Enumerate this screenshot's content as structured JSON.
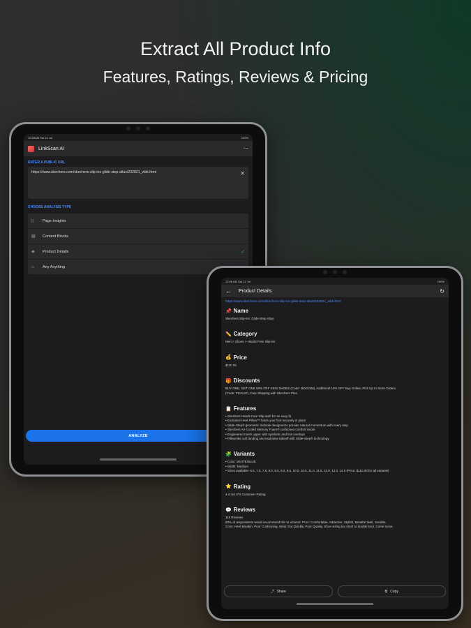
{
  "hero": {
    "title": "Extract All Product Info",
    "subtitle": "Features, Ratings, Reviews & Pricing"
  },
  "tablet_left": {
    "status": {
      "time": "10:46AM  Sat 12 Jul",
      "battery": "100%"
    },
    "app_title": "LinkScan AI",
    "menu_icon": "more-icon",
    "url_section_label": "ENTER A PUBLIC URL",
    "url_value": "https://www.skechers.com/skechers-slip-ins-glide-step-altus/232821_wbk.html",
    "analysis_label": "CHOOSE ANALYSIS TYPE",
    "analysis_options": [
      {
        "label": "Page Insights",
        "icon": "page-icon",
        "selected": false
      },
      {
        "label": "Content Blocks",
        "icon": "blocks-icon",
        "selected": false
      },
      {
        "label": "Product Details",
        "icon": "bag-icon",
        "selected": true
      },
      {
        "label": "Any Anything",
        "icon": "home-icon",
        "selected": false
      }
    ],
    "analyze_label": "ANALYZE"
  },
  "tablet_right": {
    "status": {
      "time": "12:46 AM  Sat 12 Jul",
      "battery": "100%"
    },
    "title": "Product Details",
    "link": "https://www.skechers.com/skechers-slip-ins-glide-step-altus/232821_wbk.html",
    "sections": {
      "name": {
        "emoji": "📌",
        "heading": "Name",
        "text": "Skechers Slip-ins: Glide-Step Altus"
      },
      "category": {
        "emoji": "✏️",
        "heading": "Category",
        "text": "Men > Shoes > Hands Free Slip-ins"
      },
      "price": {
        "emoji": "💰",
        "heading": "Price",
        "text": "$110.00"
      },
      "discounts": {
        "emoji": "🎁",
        "heading": "Discounts",
        "lines": [
          "BUY ONE, GET ONE 50% OFF KIDS SHOES (Code: BOGO50), Additional 10% OFF Buy Online, Pick Up In Store Orders",
          "(Code: PICKUP). Free Shipping with Skechers Plus."
        ]
      },
      "features": {
        "emoji": "📋",
        "heading": "Features",
        "lines": [
          "• Skechers Hands Free Slip-ins® for an easy fit",
          "• Exclusive Heel Pillow™ holds your foot securely in place",
          "• Glide-Step® geometric midsole designed to provide natural momentum with every step",
          "• Skechers Air-Cooled Memory Foam® cushioned comfort insole",
          "• Engineered mesh upper with synthetic and knit overlays",
          "• Pillow-like soft landing and explosive takeoff with Glide-Step® technology"
        ]
      },
      "variants": {
        "emoji": "🧩",
        "heading": "Variants",
        "lines": [
          "• Color: WHITE/BLUE",
          "• Width: Medium",
          "• Sizes available: 6.5, 7.0, 7.5, 8.0, 8.5, 9.0, 9.5, 10.0, 10.5, 11.0, 11.5, 12.0, 13.0, 14.0 (Price: $110.00 for all variants)"
        ]
      },
      "rating": {
        "emoji": "⭐",
        "heading": "Rating",
        "text": "4.4 out of 5 Customer Rating"
      },
      "reviews": {
        "emoji": "💬",
        "heading": "Reviews",
        "lines": [
          "115 Reviews",
          "83% of respondents would recommend this to a friend. Pros: Comfortable, Attractive, Stylish, Breathe Well, Durable.",
          "Cons: Heel Breakin, Poor Cushioning, Wear Out Quickly, Poor Quality, Shoe sizing too short to double knot. Come loose."
        ]
      }
    },
    "share_label": "Share",
    "copy_label": "Copy"
  }
}
